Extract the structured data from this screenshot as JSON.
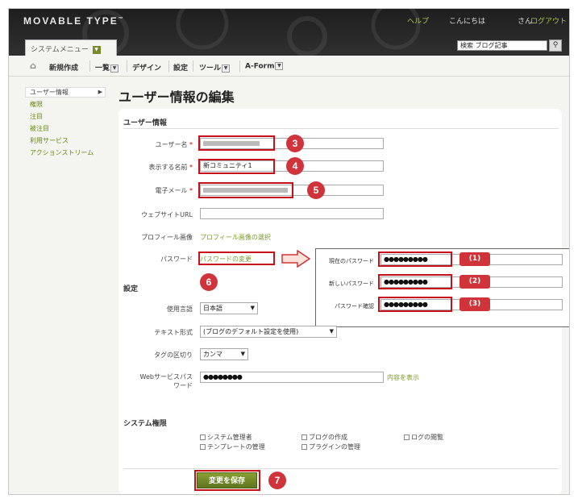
{
  "header": {
    "logo": "MOVABLE TYPE",
    "help": "ヘルプ",
    "greeting": "こんにちは",
    "san": "さん",
    "logout": "ログアウト",
    "system_menu": "システムメニュー",
    "search_value": "検索 ブログ記事"
  },
  "nav": {
    "new": "新規作成",
    "list": "一覧",
    "design": "デザイン",
    "settings": "設定",
    "tools": "ツール",
    "aform": "A-Form"
  },
  "sidebar": {
    "items": [
      "ユーザー情報",
      "権限",
      "注目",
      "被注目",
      "利用サービス",
      "アクションストリーム"
    ]
  },
  "page_title": "ユーザー情報の編集",
  "user_info": {
    "section": "ユーザー情報",
    "username_label": "ユーザー名",
    "display_name_label": "表示する名前",
    "display_name_value": "新コミュニティ1",
    "email_label": "電子メール",
    "website_label": "ウェブサイトURL",
    "profile_image_label": "プロフィール画像",
    "profile_image_link": "プロフィール画像の選択",
    "password_label": "パスワード",
    "password_link": "パスワードの変更"
  },
  "password_popup": {
    "current_label": "現在のパスワード",
    "new_label": "新しいパスワード",
    "confirm_label": "パスワード確認",
    "current_value": "●●●●●●●●●",
    "new_value": "●●●●●●●●●",
    "confirm_value": "●●●●●●●●●",
    "badges": [
      "(1)",
      "(2)",
      "(3)"
    ]
  },
  "settings": {
    "section": "設定",
    "language_label": "使用言語",
    "language_value": "日本語",
    "text_format_label": "テキスト形式",
    "text_format_value": "(ブログのデフォルト設定を使用)",
    "tag_delim_label": "タグの区切り",
    "tag_delim_value": "カンマ",
    "web_password_label_1": "Webサービスパス",
    "web_password_label_2": "ワード",
    "web_password_value": "●●●●●●●●",
    "show_content": "内容を表示"
  },
  "permissions": {
    "section": "システム権限",
    "system_admin": "システム管理者",
    "create_blog": "ブログの作成",
    "view_log": "ログの閲覧",
    "manage_templates": "テンプレートの管理",
    "manage_plugins": "プラグインの管理"
  },
  "save_label": "変更を保存",
  "badges": [
    "3",
    "4",
    "5",
    "6",
    "7"
  ],
  "colors": {
    "accent_green": "#7a9a2a",
    "annotation_red": "#c8101a"
  }
}
